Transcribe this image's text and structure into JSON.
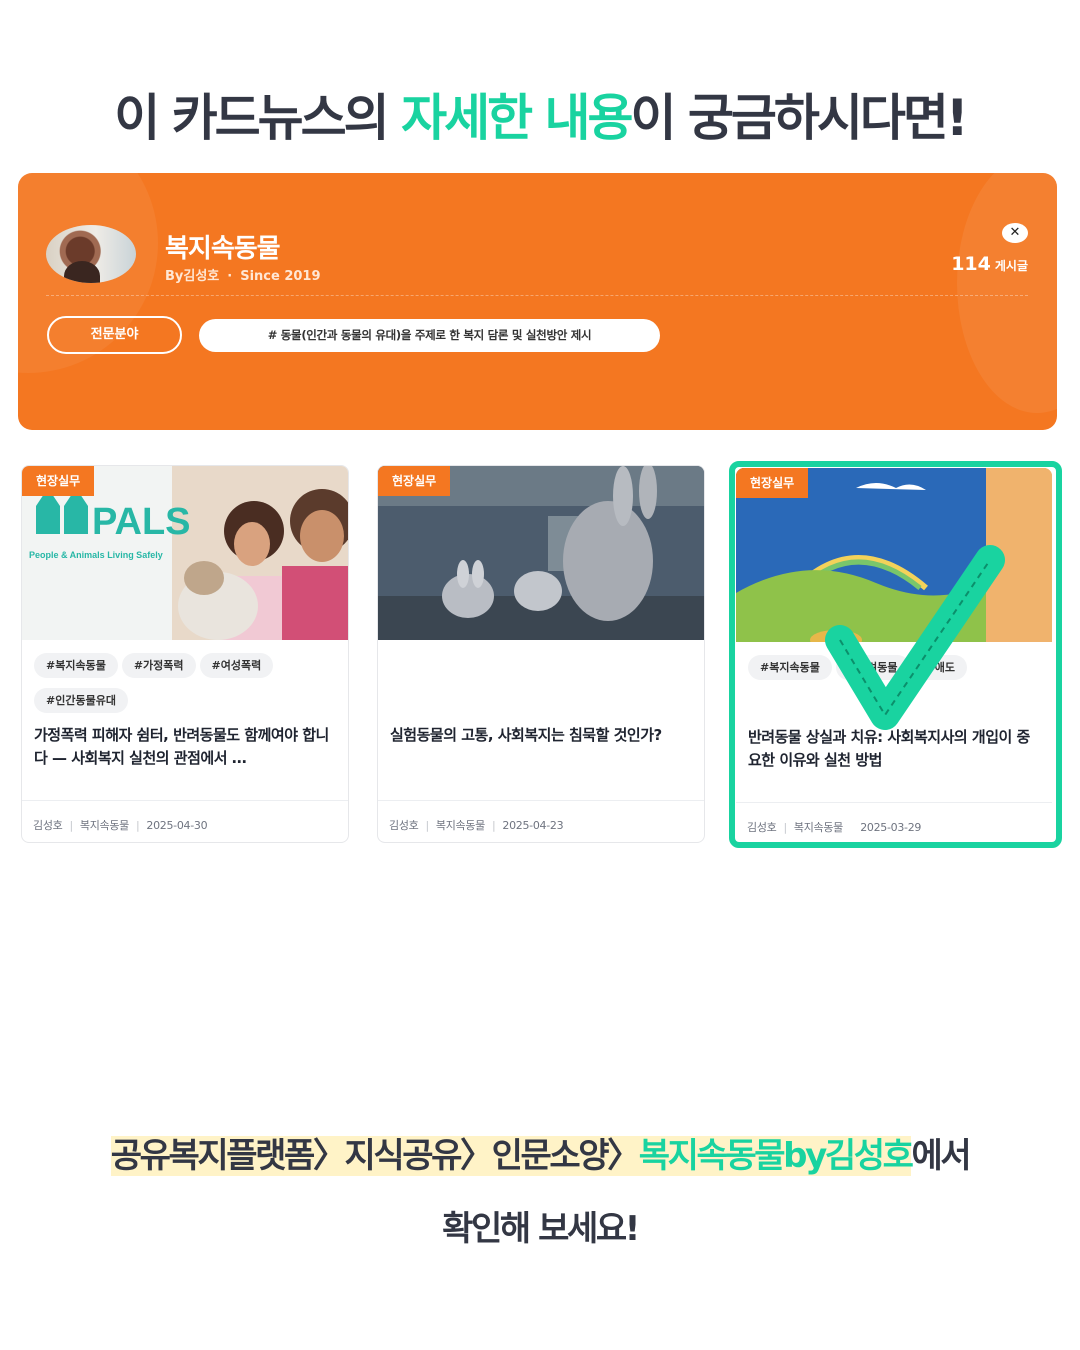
{
  "headline": {
    "part1": "이 카드뉴스의 ",
    "highlight": "자세한 내용",
    "part2": "이 궁금하시다면!"
  },
  "blog": {
    "title": "복지속동물",
    "author": "By김성호",
    "dot": "·",
    "since": "Since 2019",
    "close_icon": "✕",
    "post_count": "114",
    "post_count_label": "게시글",
    "field_button": "전문분야",
    "field_tag": "# 동물(인간과 동물의 유대)을 주제로 한 복지 담론 및 실천방안 제시"
  },
  "cards": [
    {
      "badge": "현장실무",
      "tags": [
        "#복지속동물",
        "#가정폭력",
        "#여성폭력",
        "#인간동물유대"
      ],
      "title": "가정폭력 피해자 쉼터, 반려동물도 함께여야 합니다 — 사회복지 실천의 관점에서 …",
      "author": "김성호",
      "blog": "복지속동물",
      "date": "2025-04-30",
      "thumb_logo": "PALS",
      "thumb_logo_sub": "People & Animals Living Safely"
    },
    {
      "badge": "현장실무",
      "tags": [],
      "title": "실험동물의 고통, 사회복지는 침묵할 것인가?",
      "author": "김성호",
      "blog": "복지속동물",
      "date": "2025-04-23"
    },
    {
      "badge": "현장실무",
      "tags": [
        "#복지속동물",
        "#반려동물",
        "#애도"
      ],
      "title": "반려동물 상실과 치유: 사회복지사의 개입이 중요한 이유와 실천 방법",
      "author": "김성호",
      "blog": "복지속동물",
      "date": "2025-03-29"
    }
  ],
  "bottom": {
    "path": "공유복지플랫폼〉지식공유〉인문소양〉",
    "accent": "복지속동물by김성호",
    "suffix": "에서",
    "line2": "확인해 보세요!"
  },
  "colors": {
    "accent_green": "#19d3a0",
    "banner_orange": "#f47721",
    "path_highlight": "#fff3c7"
  }
}
